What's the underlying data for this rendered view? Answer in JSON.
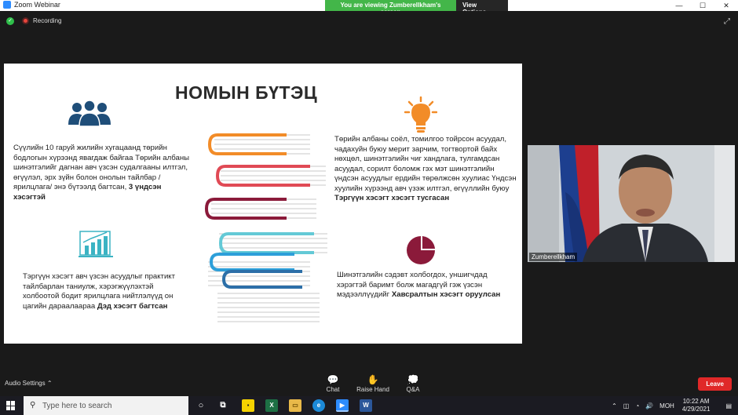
{
  "window": {
    "app_title": "Zoom Webinar"
  },
  "banner": {
    "message": "You are viewing Zumberellkham's screen",
    "view_options": "View Options ⌄"
  },
  "window_controls": {
    "minimize": "—",
    "maximize": "☐",
    "close": "✕"
  },
  "meeting": {
    "recording_label": "Recording"
  },
  "slide": {
    "title": "НОМЫН БҮТЭЦ",
    "section1": {
      "text": "Сүүлийн 10 гаруй жилийн хугацаанд төрийн бодлогын хүрээнд явагдаж байгаа Төрийн албаны шинэтгэлийг дагнан авч үзсэн судалгааны илтгэл, өгүүлэл, эрх зүйн болон онолын тайлбар /ярилцлага/ энэ бүтээлд багтсан, ",
      "bold": "3 үндсэн хэсэгтэй"
    },
    "section2": {
      "text": "Төрийн албаны соёл, томилгоо тойрсон асуудал, чадахуйн буюу мерит зарчим, тогтвортой байх нөхцөл, шинэтгэлийн чиг хандлага, тулгамдсан асуудал, сорилт боломж гэх мэт шинэтгэлийн үндсэн асуудлыг ердийн төрөлжсөн хуулиас Үндсэн хуулийн хүрээнд авч үзэж илтгэл, өгүүллийн буюу ",
      "bold": "Тэргүүн хэсэгт хэсэгт тусгасан"
    },
    "section3": {
      "text": "Тэргүүн хэсэгт авч үзсэн асуудлыг практикт тайлбарлан таниулж, хэрэгжүүлэхтэй холбоотой бодит ярилцлага нийтлэлүүд он цагийн дараалаараа ",
      "bold": "Дэд хэсэгт багтсан"
    },
    "section4": {
      "text": "Шинэтгэлийн сэдэвт холбогдох, уншигчдад хэрэгтэй баримт болж магадгүй гэж үзсэн мэдээллүүдийг ",
      "bold": "Хавсралтын хэсэгт оруулсан"
    }
  },
  "video": {
    "participant_name": "Zumberellkham"
  },
  "controls": {
    "audio_settings": "Audio Settings ⌃",
    "chat": "Chat",
    "raise_hand": "Raise Hand",
    "qa": "Q&A",
    "leave": "Leave"
  },
  "taskbar": {
    "search_placeholder": "Type here to search",
    "language": "МОН",
    "time": "10:22 AM",
    "date": "4/29/2021"
  },
  "colors": {
    "zoom_blue": "#2d8cff",
    "banner_green": "#43b649",
    "leave_red": "#e02828",
    "icon_navy": "#1f4e79",
    "bulb_orange": "#f28c28",
    "chart_teal": "#3bb3c3",
    "pie_maroon": "#8b1a3a"
  }
}
